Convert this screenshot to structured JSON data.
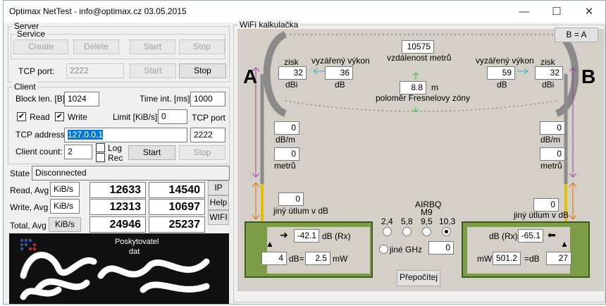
{
  "window": {
    "title": "Optimax NetTest - info@optimax.cz 03.05.2015",
    "minimize": "—",
    "maximize": "☐",
    "close": "✕"
  },
  "server": {
    "group": "Server",
    "service_group": "Service",
    "create": "Create",
    "delete": "Delete",
    "start": "Start",
    "stop": "Stop",
    "tcp_port_label": "TCP port:",
    "tcp_port": "2222",
    "start2": "Start",
    "stop2": "Stop"
  },
  "client": {
    "group": "Client",
    "block_len_label": "Block len. [B]:",
    "block_len": "1024",
    "time_int_label": "Time int. [ms] :",
    "time_int": "1000",
    "read": "Read",
    "write": "Write",
    "limit_label": "Limit [KiB/s]:",
    "limit": "0",
    "tcp_port_label": "TCP port",
    "tcp_address_label": "TCP address:",
    "tcp_address": "127.0.0.1",
    "tcp_port": "2222",
    "client_count_label": "Client count:",
    "client_count": "2",
    "log": "Log",
    "rec": "Rec",
    "start": "Start",
    "stop": "Stop"
  },
  "state": {
    "label": "State",
    "value": "Disconnected"
  },
  "stats": {
    "read_label": "Read, Avg",
    "write_label": "Write, Avg",
    "total_label": "Total, Avg",
    "unit": "KiB/s",
    "read1": "12633",
    "read2": "14540",
    "write1": "12313",
    "write2": "10697",
    "total1": "24946",
    "total2": "25237",
    "ip": "IP",
    "help": "Help",
    "wifi": "WIFI"
  },
  "banner": {
    "text1": "Poskytovatel",
    "text2": "dat"
  },
  "wifi": {
    "group": "WiFi kalkulačka",
    "ba": "B = A",
    "a": "A",
    "b": "B",
    "zisk": "zisk",
    "dbi": "dBi",
    "vyzareny": "vyzářený výkon",
    "db": "dB",
    "gain_a": "32",
    "power_a": "36",
    "power_b": "59",
    "gain_b": "32",
    "distance": "10575",
    "distance_label": "vzdálenost metrů",
    "fresnel": "8.8",
    "m": "m",
    "fresnel_label": "poloměr Fresnelovy zóny",
    "dbm": "dB/m",
    "metru": "metrů",
    "cable_a": "0",
    "len_a": "0",
    "cable_b": "0",
    "len_b": "0",
    "other_label": "jiný útlum v dB",
    "other_a": "0",
    "other_b": "0",
    "airbq": "AIRBQ",
    "m9": "M9",
    "f24": "2,4",
    "f58": "5,8",
    "f95": "9,5",
    "f103": "10,3",
    "jine": "jiné GHz",
    "jine_val": "0",
    "rx_a": "-42.1",
    "rx_label": "dB (Rx)",
    "db_a": "4",
    "deq": "dB=",
    "mw_a": "2.5",
    "mw": "mW",
    "rx_label_b": "dB (Rx)",
    "rx_b": "-65.1",
    "mw_label_b": "mW",
    "mw_b": "501.2",
    "deq_b": "=dB",
    "db_b": "27",
    "recalc": "Přepočítej"
  }
}
